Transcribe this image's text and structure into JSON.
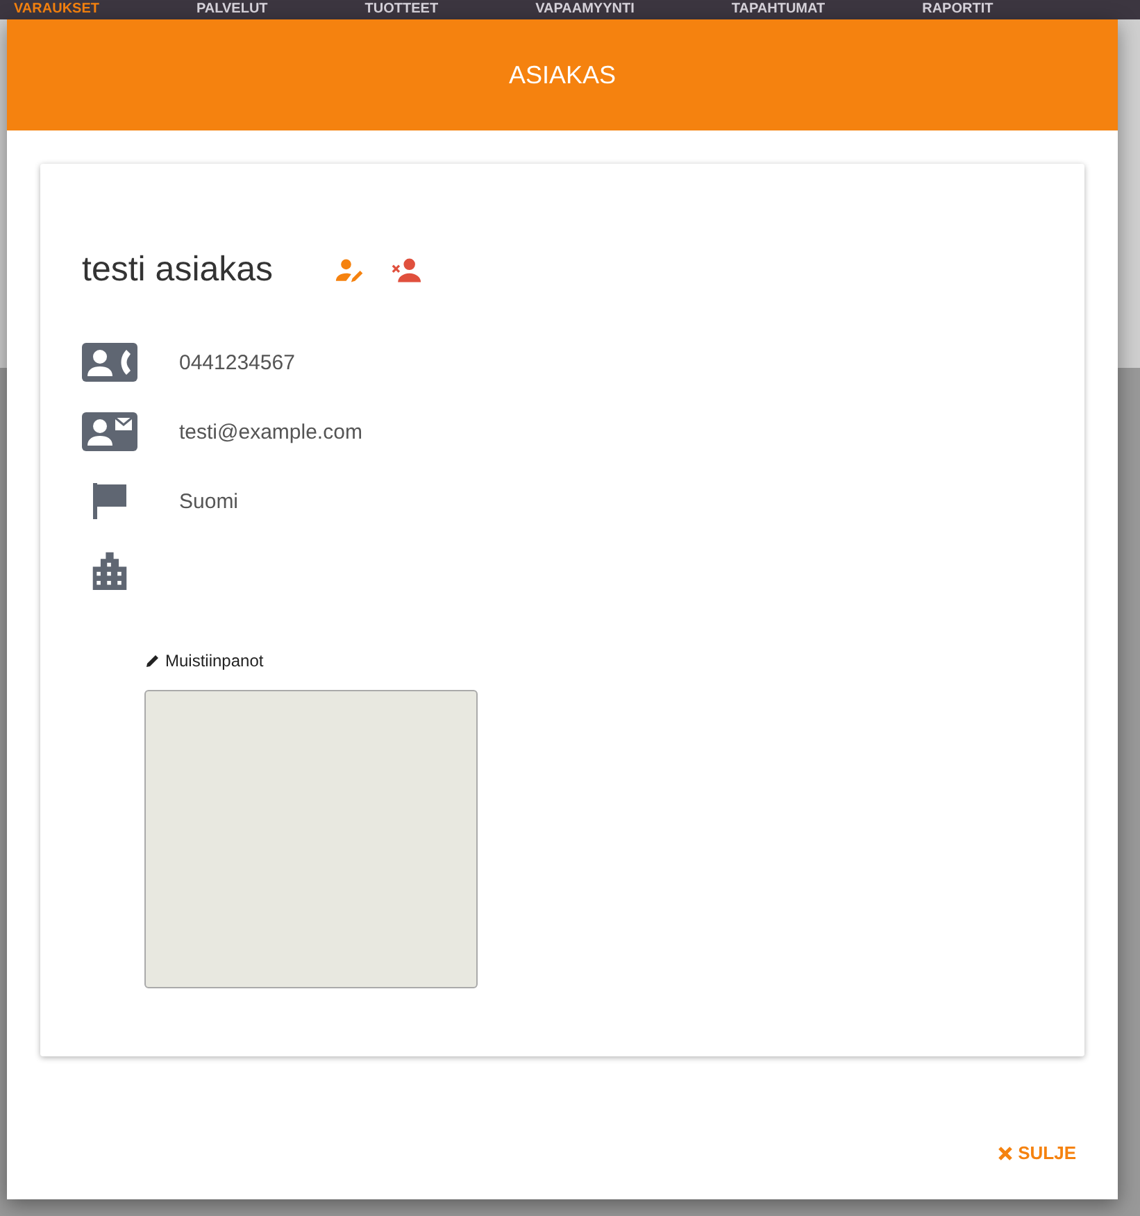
{
  "nav": [
    {
      "label": "VARAUKSET",
      "selected": true
    },
    {
      "label": "PALVELUT",
      "selected": false
    },
    {
      "label": "TUOTTEET",
      "selected": false
    },
    {
      "label": "VAPAAMYYNTI",
      "selected": false
    },
    {
      "label": "TAPAHTUMAT",
      "selected": false
    },
    {
      "label": "RAPORTIT",
      "selected": false
    }
  ],
  "dialog": {
    "title": "ASIAKAS",
    "name": "testi asiakas",
    "details": [
      {
        "kind": "phone",
        "value": "0441234567"
      },
      {
        "kind": "email",
        "value": "testi@example.com"
      },
      {
        "kind": "country",
        "value": "Suomi"
      },
      {
        "kind": "company"
      }
    ],
    "notes": {
      "label": "Muistiinpanot"
    },
    "close_button": "SULJE"
  }
}
